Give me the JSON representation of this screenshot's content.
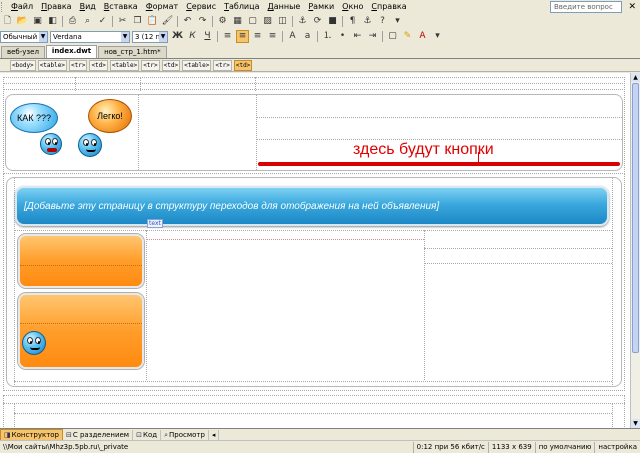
{
  "menu": {
    "items": [
      "Файл",
      "Правка",
      "Вид",
      "Вставка",
      "Формат",
      "Сервис",
      "Таблица",
      "Данные",
      "Рамки",
      "Окно",
      "Справка"
    ],
    "help_placeholder": "Введите вопрос",
    "close": "✕"
  },
  "formatting": {
    "style": "Обычный",
    "font": "Verdana",
    "size": "3 (12 пт)",
    "bold": "Ж",
    "italic": "К",
    "underline": "Ч"
  },
  "tabs": [
    {
      "label": "веб-узел",
      "active": false
    },
    {
      "label": "index.dwt",
      "active": true
    },
    {
      "label": "нов_стр_1.htm*",
      "active": false
    }
  ],
  "tag_selector": [
    "<body>",
    "<table>",
    "<tr>",
    "<td>",
    "<table>",
    "<tr>",
    "<td>",
    "<table>",
    "<tr>",
    "<td>"
  ],
  "header": {
    "bubble_left": "КАК ???",
    "bubble_right": "Легко!",
    "buttons_placeholder": "здесь будут кнопки"
  },
  "banner": {
    "text": "[Добавьте эту страницу в структуру переходов для отображения на ней объявления]"
  },
  "text_marker": "text",
  "view_tabs": [
    {
      "label": "Конструктор",
      "icon": "design-icon",
      "active": true
    },
    {
      "label": "С разделением",
      "icon": "split-icon",
      "active": false
    },
    {
      "label": "Код",
      "icon": "code-icon",
      "active": false
    },
    {
      "label": "Просмотр",
      "icon": "preview-icon",
      "active": false
    }
  ],
  "status": {
    "path": "\\\\Мои сайты\\Mhz3p.5pb.ru\\_private",
    "download": "0:12 при 56 кбит/с",
    "dimensions": "1133 x 639",
    "mode": "по умолчанию",
    "custom": "настройка"
  },
  "colors": {
    "accent_orange": "#ff9d2a",
    "banner_blue": "#2a9bd6",
    "placeholder_red": "#e00000"
  }
}
